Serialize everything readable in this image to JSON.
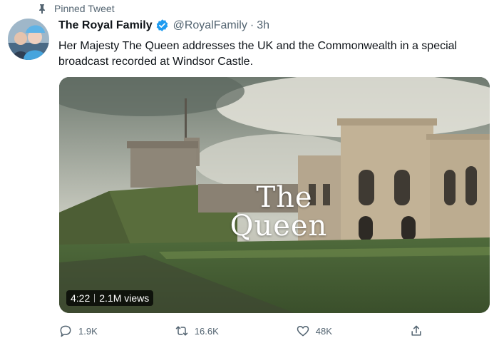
{
  "pinned": {
    "label": "Pinned Tweet",
    "icon": "pin-icon"
  },
  "author": {
    "name": "The Royal Family",
    "verified_icon": "verified-badge-icon",
    "handle": "@RoyalFamily",
    "separator": "·",
    "time": "3h"
  },
  "tweet": {
    "text": "Her Majesty The Queen addresses the UK and the Commonwealth in a special broadcast recorded at Windsor Castle."
  },
  "video": {
    "overlay_line1": "The",
    "overlay_line2": "Queen",
    "duration": "4:22",
    "views": "2.1M views"
  },
  "actions": {
    "replies": "1.9K",
    "retweets": "16.6K",
    "likes": "48K"
  },
  "colors": {
    "accent": "#1d9bf0",
    "text_primary": "#0f1419",
    "text_secondary": "#536471"
  }
}
